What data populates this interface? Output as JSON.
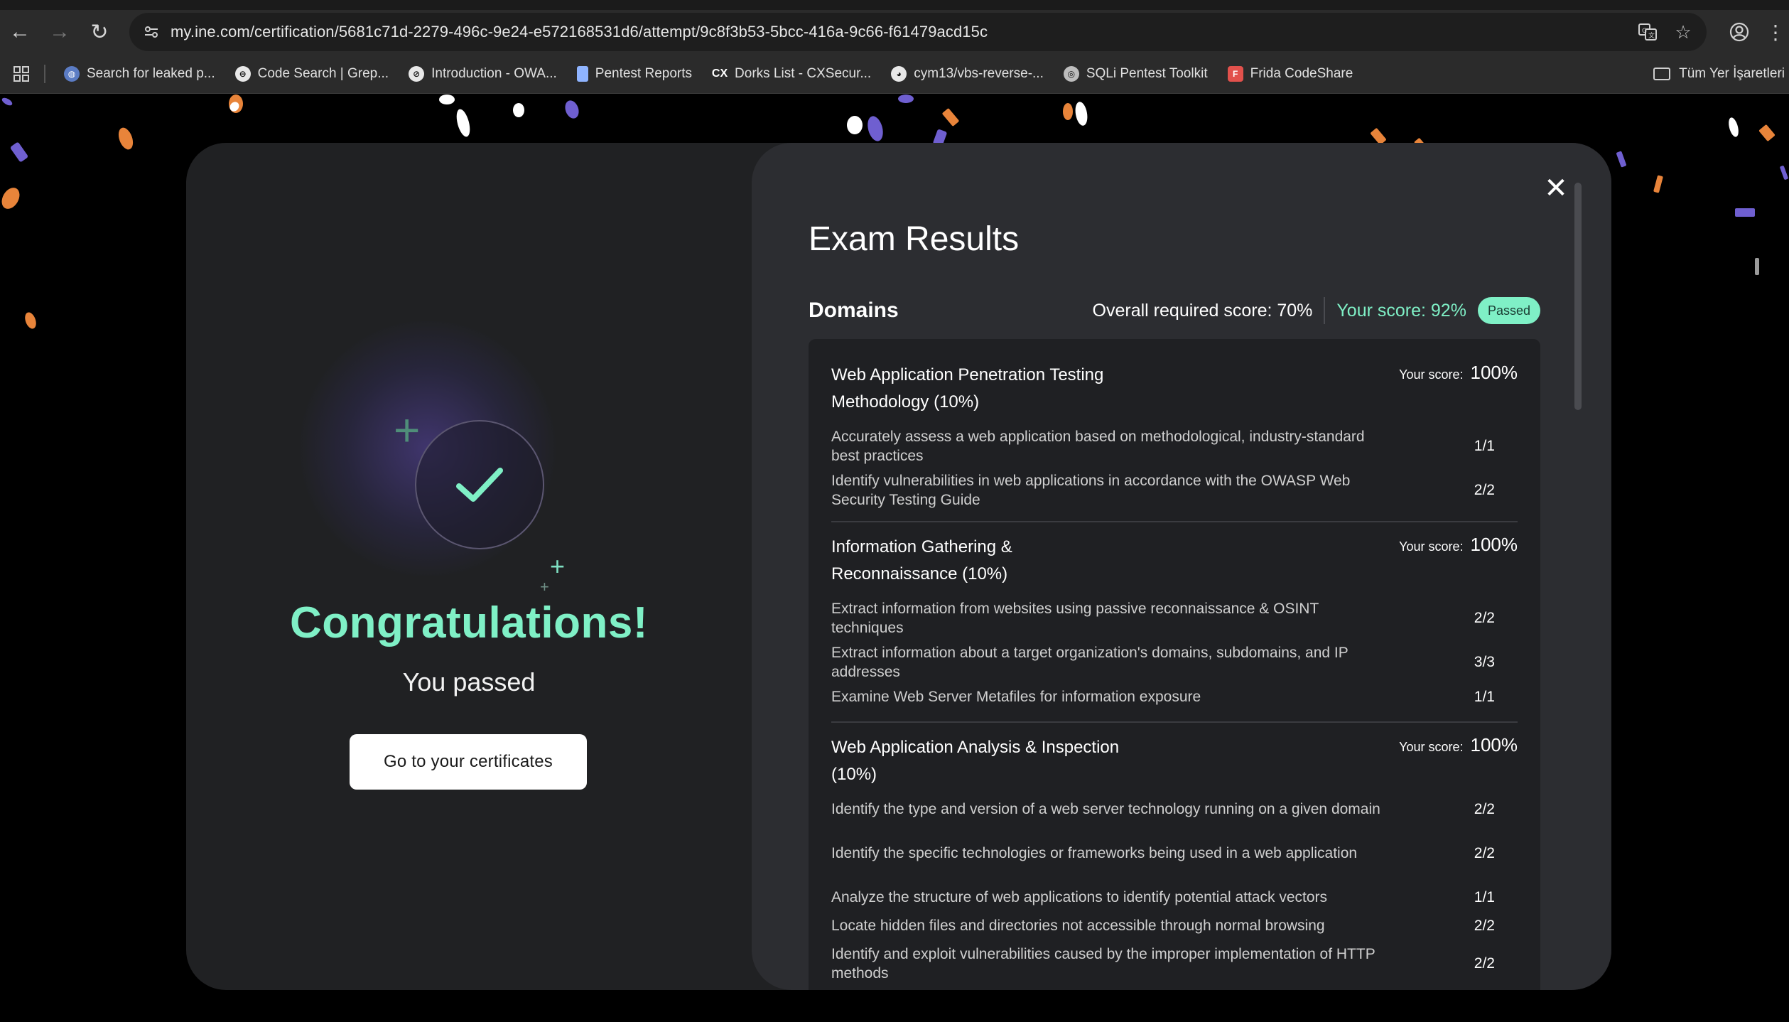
{
  "browser": {
    "url": "my.ine.com/certification/5681c71d-2279-496c-9e24-e572168531d6/attempt/9c8f3b53-5bcc-416a-9c66-f61479acd15c",
    "bookmarks": [
      {
        "label": "Search for leaked p...",
        "icon": "globe-icon"
      },
      {
        "label": "Code Search | Grep...",
        "icon": "grep-icon"
      },
      {
        "label": "Introduction - OWA...",
        "icon": "owasp-icon"
      },
      {
        "label": "Pentest Reports",
        "icon": "doc-icon"
      },
      {
        "label": "Dorks List - CXSecur...",
        "icon": "cx-icon"
      },
      {
        "label": "cym13/vbs-reverse-...",
        "icon": "github-icon"
      },
      {
        "label": "SQLi Pentest Toolkit",
        "icon": "sqli-icon"
      },
      {
        "label": "Frida CodeShare",
        "icon": "frida-icon"
      }
    ],
    "all_bookmarks_label": "Tüm Yer İşaretleri"
  },
  "left": {
    "title": "Congratulations!",
    "subtitle": "You passed",
    "button_label": "Go to your certificates"
  },
  "results": {
    "title": "Exam Results",
    "domains_label": "Domains",
    "required_score": "Overall required score: 70%",
    "your_score": "Your score: 92%",
    "status_badge": "Passed",
    "domains": [
      {
        "name": "Web Application Penetration Testing Methodology (10%)",
        "score_label": "Your score:",
        "score": "100%",
        "objectives": [
          {
            "text": "Accurately assess a web application based on methodological, industry-standard best practices",
            "score": "1/1"
          },
          {
            "text": "Identify vulnerabilities in web applications in accordance with the OWASP Web Security Testing Guide",
            "score": "2/2"
          }
        ]
      },
      {
        "name": "Information Gathering & Reconnaissance (10%)",
        "score_label": "Your score:",
        "score": "100%",
        "objectives": [
          {
            "text": "Extract information from websites using passive reconnaissance & OSINT techniques",
            "score": "2/2"
          },
          {
            "text": "Extract information about a target organization's domains, subdomains, and IP addresses",
            "score": "3/3"
          },
          {
            "text": "Examine Web Server Metafiles for information exposure",
            "score": "1/1"
          }
        ]
      },
      {
        "name": "Web Application Analysis & Inspection (10%)",
        "score_label": "Your score:",
        "score": "100%",
        "objectives": [
          {
            "text": "Identify the type and version of a web server technology running on a given domain",
            "score": "2/2"
          },
          {
            "text": "Identify the specific technologies or frameworks being used in a web application",
            "score": "2/2"
          },
          {
            "text": "Analyze the structure of web applications to identify potential attack vectors",
            "score": "1/1"
          },
          {
            "text": "Locate hidden files and directories not accessible through normal browsing",
            "score": "2/2"
          },
          {
            "text": "Identify and exploit vulnerabilities caused by the improper implementation of HTTP methods",
            "score": "2/2"
          }
        ]
      }
    ]
  },
  "colors": {
    "accent": "#7ff0c6",
    "modal_left": "#202123",
    "modal_right": "#2c2d31",
    "confetti_orange": "#e8843a",
    "confetti_purple": "#6f5fd0",
    "confetti_white": "#ffffff"
  }
}
